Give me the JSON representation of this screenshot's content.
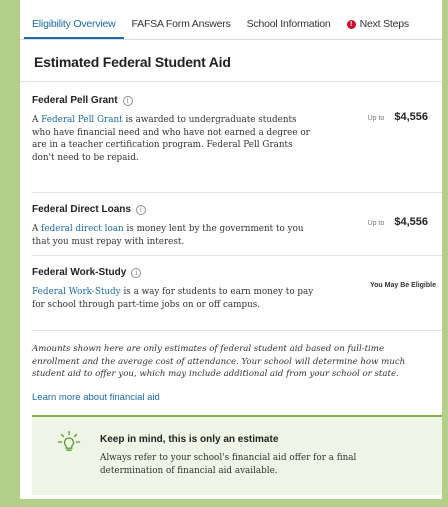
{
  "tabs": [
    {
      "label": "Eligibility Overview",
      "active": true
    },
    {
      "label": "FAFSA Form Answers",
      "active": false
    },
    {
      "label": "School Information",
      "active": false
    },
    {
      "label": "Next Steps",
      "active": false,
      "icon": "alert-icon"
    }
  ],
  "page_title": "Estimated Federal Student Aid",
  "aid": [
    {
      "heading": "Federal Pell Grant",
      "link_text": "Federal Pell Grant",
      "text_before": "A ",
      "text_after": " is awarded to undergraduate students who have financial need and who have not earned a degree or are in a teacher certification program. Federal Pell Grants don't need to be repaid.",
      "upto": "Up to",
      "amount": "$4,556"
    },
    {
      "heading": "Federal Direct Loans",
      "link_text": "federal direct loan",
      "text_before": "A ",
      "text_after": " is money lent by the government to you that you must repay with interest.",
      "upto": "Up to",
      "amount": "$4,556"
    },
    {
      "heading": "Federal Work-Study",
      "link_text": "Federal Work-Study",
      "text_before": "",
      "text_after": " is a way for students to earn money to pay for school through part-time jobs on or off campus.",
      "status": "You May Be Eligible"
    }
  ],
  "disclaimer": "Amounts shown here are only estimates of federal student aid based on full-time enrollment and the average cost of attendance. Your school will determine how much student aid to offer you, which may include additional aid from your school or state.",
  "learn_more": "Learn more about financial aid",
  "estimate_note": {
    "title": "Keep in mind, this is only an estimate",
    "text": "Always refer to your school's financial aid offer for a final determination of financial aid available.",
    "icon": "lightbulb-icon"
  },
  "colors": {
    "accent": "#1c6aa6",
    "alert": "#c8102e",
    "note_border": "#7fb04c",
    "frame": "#b4cf8a"
  }
}
